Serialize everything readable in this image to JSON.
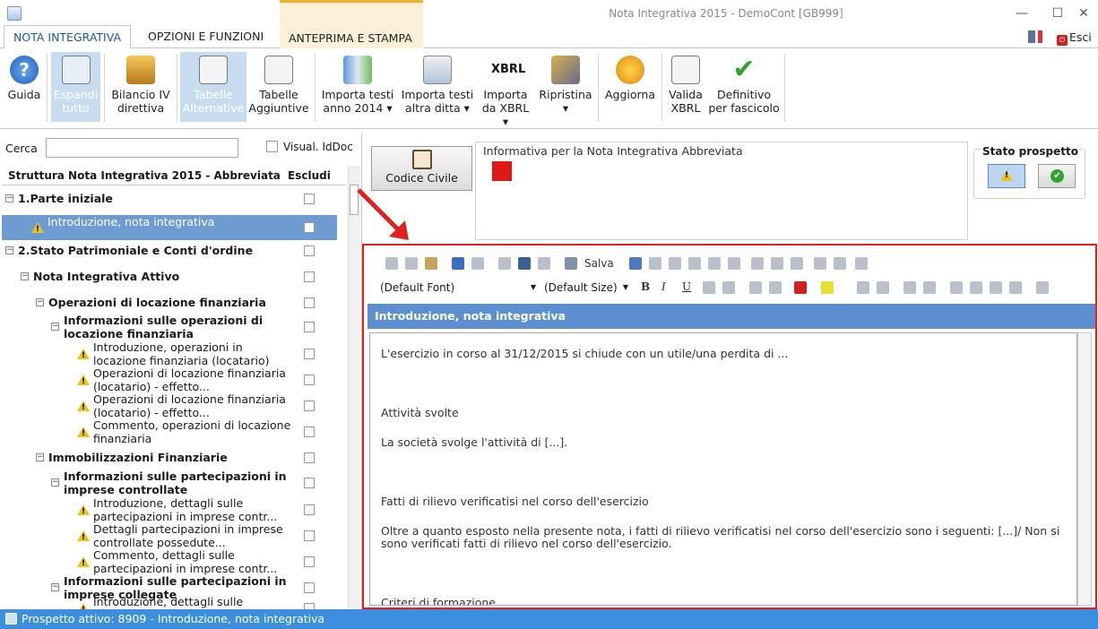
{
  "window": {
    "title": "Nota Integrativa 2015 - DemoCont [GB999]",
    "minimize": "—",
    "maximize": "☐",
    "close": "✕"
  },
  "tabs": [
    {
      "label": "NOTA INTEGRATIVA",
      "active": true
    },
    {
      "label": "OPZIONI E FUNZIONI",
      "active": false
    },
    {
      "label": "ANTEPRIMA E STAMPA",
      "active": false
    }
  ],
  "exit": {
    "label": "Esci",
    "icon": "power-icon"
  },
  "ribbon": [
    {
      "l1": "Guida",
      "l2": "",
      "icon": "help-icon"
    },
    {
      "l1": "Espandi",
      "l2": "tutto",
      "icon": "expand-icon"
    },
    {
      "l1": "Bilancio IV",
      "l2": "direttiva",
      "icon": "scales-icon"
    },
    {
      "l1": "Tabelle",
      "l2": "Alternative",
      "icon": "table-alt-icon"
    },
    {
      "l1": "Tabelle",
      "l2": "Aggiuntive",
      "icon": "table-add-icon"
    },
    {
      "l1": "Importa testi",
      "l2": "anno 2014 ▾",
      "icon": "import-icon"
    },
    {
      "l1": "Importa testi",
      "l2": "altra ditta ▾",
      "icon": "import-company-icon"
    },
    {
      "l1": "Importa",
      "l2": "da XBRL ▾",
      "icon": "xbrl-icon"
    },
    {
      "l1": "Ripristina",
      "l2": "▾",
      "icon": "broom-icon"
    },
    {
      "l1": "Aggiorna",
      "l2": "",
      "icon": "refresh-icon"
    },
    {
      "l1": "Valida",
      "l2": "XBRL",
      "icon": "validate-icon"
    },
    {
      "l1": "Definitivo",
      "l2": "per fascicolo",
      "icon": "check-icon"
    }
  ],
  "search": {
    "label": "Cerca",
    "value": "",
    "idoc_label": "Visual. IdDoc"
  },
  "tree_header": {
    "title": "Struttura Nota Integrativa 2015 - Abbreviata",
    "exclude": "Escludi"
  },
  "tree": [
    {
      "text": "1.Parte iniziale",
      "bold": true,
      "level": 0
    },
    {
      "text": "Introduzione, nota integrativa",
      "bold": false,
      "level": 1,
      "warn": true,
      "selected": true
    },
    {
      "text": "2.Stato Patrimoniale e Conti d'ordine",
      "bold": true,
      "level": 0
    },
    {
      "text": "Nota Integrativa Attivo",
      "bold": true,
      "level": 1
    },
    {
      "text": "Operazioni di locazione finanziaria",
      "bold": true,
      "level": 2
    },
    {
      "text": "Informazioni sulle operazioni di locazione finanziaria",
      "bold": true,
      "level": 3
    },
    {
      "text": "Introduzione, operazioni in locazione finanziaria (locatario)",
      "bold": false,
      "level": 4,
      "warn": true
    },
    {
      "text": "Operazioni di locazione finanziaria (locatario) - effetto...",
      "bold": false,
      "level": 4,
      "warn": true
    },
    {
      "text": "Operazioni di locazione finanziaria (locatario) - effetto...",
      "bold": false,
      "level": 4,
      "warn": true
    },
    {
      "text": "Commento, operazioni di locazione finanziaria",
      "bold": false,
      "level": 4,
      "warn": true
    },
    {
      "text": "Immobilizzazioni Finanziarie",
      "bold": true,
      "level": 2
    },
    {
      "text": "Informazioni sulle partecipazioni in imprese controllate",
      "bold": true,
      "level": 3
    },
    {
      "text": "Introduzione, dettagli sulle partecipazioni in imprese contr...",
      "bold": false,
      "level": 4,
      "warn": true
    },
    {
      "text": "Dettagli partecipazioni in imprese controllate possedute...",
      "bold": false,
      "level": 4,
      "warn": true
    },
    {
      "text": "Commento, dettagli sulle partecipazioni in imprese contr...",
      "bold": false,
      "level": 4,
      "warn": true
    },
    {
      "text": "Informazioni sulle partecipazioni in imprese collegate",
      "bold": true,
      "level": 3
    },
    {
      "text": "Introduzione, dettagli sulle",
      "bold": false,
      "level": 4,
      "warn": true
    }
  ],
  "codice_civile": {
    "label": "Codice Civile"
  },
  "info": {
    "title": "Informativa per la Nota Integrativa Abbreviata"
  },
  "stato": {
    "title": "Stato prospetto"
  },
  "editor": {
    "save_label": "Salva",
    "font": "(Default Font)",
    "size": "(Default Size)",
    "header": "Introduzione, nota integrativa",
    "paragraphs": [
      "L'esercizio in corso al 31/12/2015 si chiude con un utile/una perdita di ...",
      "Attività svolte",
      "La società svolge l'attività di [...].",
      "Fatti di rilievo verificatisi nel corso dell'esercizio",
      "Oltre a quanto esposto nella presente nota, i fatti di rilievo verificatisi nel corso dell'esercizio sono i seguenti: [...]/ Non si sono verificati fatti di rilievo nel corso dell'esercizio.",
      "Criteri di formazione"
    ]
  },
  "status": {
    "text": "Prospetto attivo: 8909 - Introduzione, nota integrativa"
  },
  "colors": {
    "accent": "#3c8fde",
    "header": "#5b8fcf",
    "highlight": "#e02020",
    "selection": "#6d9bd2"
  }
}
